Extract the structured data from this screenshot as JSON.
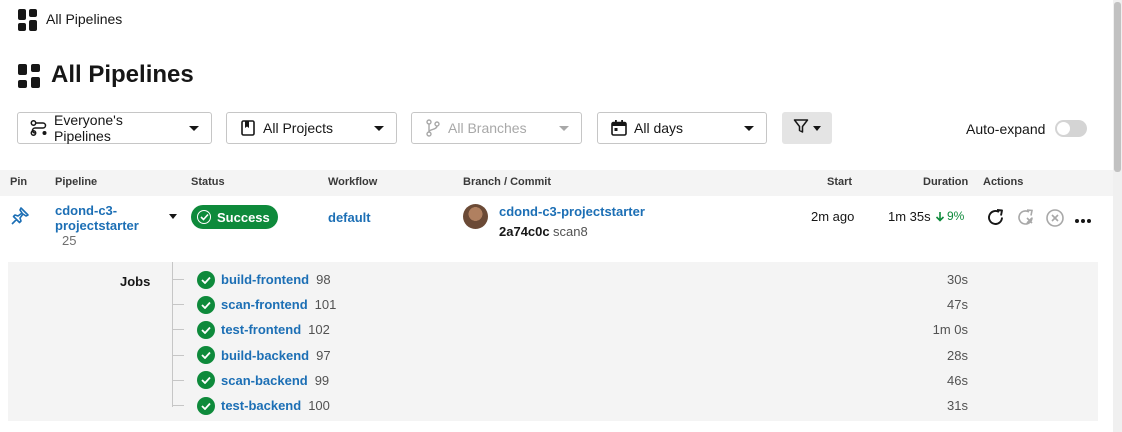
{
  "breadcrumb": {
    "title": "All Pipelines"
  },
  "page": {
    "title": "All Pipelines"
  },
  "filters": {
    "pipelines": "Everyone's Pipelines",
    "projects": "All Projects",
    "branches": "All Branches",
    "days": "All days",
    "auto_expand_label": "Auto-expand",
    "auto_expand_on": false
  },
  "table": {
    "headers": {
      "pin": "Pin",
      "pipeline": "Pipeline",
      "status": "Status",
      "workflow": "Workflow",
      "branch_commit": "Branch / Commit",
      "start": "Start",
      "duration": "Duration",
      "actions": "Actions"
    },
    "row": {
      "pipeline_name_line1": "cdond-c3-",
      "pipeline_name_line2": "projectstarter",
      "pipeline_number": "25",
      "status": "Success",
      "workflow": "default",
      "branch": "cdond-c3-projectstarter",
      "commit": "2a74c0c",
      "commit_message": "scan8",
      "start": "2m ago",
      "duration": "1m 35s",
      "duration_change": "9%"
    },
    "jobs_label": "Jobs",
    "jobs": [
      {
        "name": "build-frontend",
        "number": "98",
        "duration": "30s"
      },
      {
        "name": "scan-frontend",
        "number": "101",
        "duration": "47s"
      },
      {
        "name": "test-frontend",
        "number": "102",
        "duration": "1m 0s"
      },
      {
        "name": "build-backend",
        "number": "97",
        "duration": "28s"
      },
      {
        "name": "scan-backend",
        "number": "99",
        "duration": "46s"
      },
      {
        "name": "test-backend",
        "number": "100",
        "duration": "31s"
      }
    ]
  },
  "colors": {
    "success": "#0e8a3b",
    "link": "#1c6fb5",
    "improvement": "#0e8a3b"
  }
}
